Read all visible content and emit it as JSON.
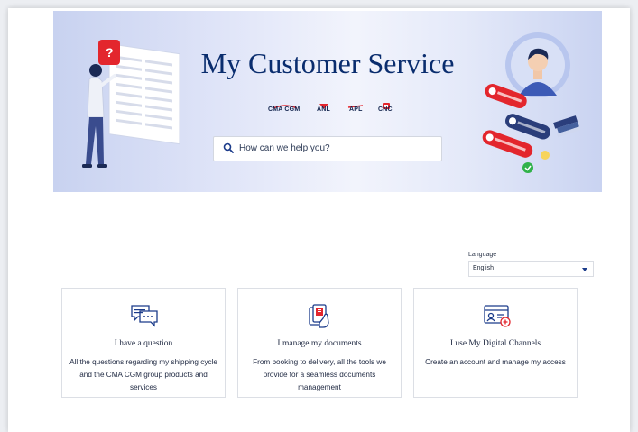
{
  "hero": {
    "title": "My Customer Service",
    "brands": [
      "CMA CGM",
      "ANL",
      "APL",
      "CNC"
    ],
    "search_placeholder": "How can we help you?"
  },
  "language": {
    "label": "Language",
    "selected": "English"
  },
  "cards": [
    {
      "icon": "chat-question-icon",
      "title": "I have a question",
      "description": "All the questions regarding my shipping cycle and the CMA CGM group products and services"
    },
    {
      "icon": "document-hand-icon",
      "title": "I manage my documents",
      "description": "From booking to delivery, all the tools we provide for a seamless documents management"
    },
    {
      "icon": "digital-id-icon",
      "title": "I use My Digital Channels",
      "description": "Create an account and manage my access"
    }
  ],
  "colors": {
    "brand_navy": "#0a2d6e",
    "accent_red": "#e3262d"
  }
}
